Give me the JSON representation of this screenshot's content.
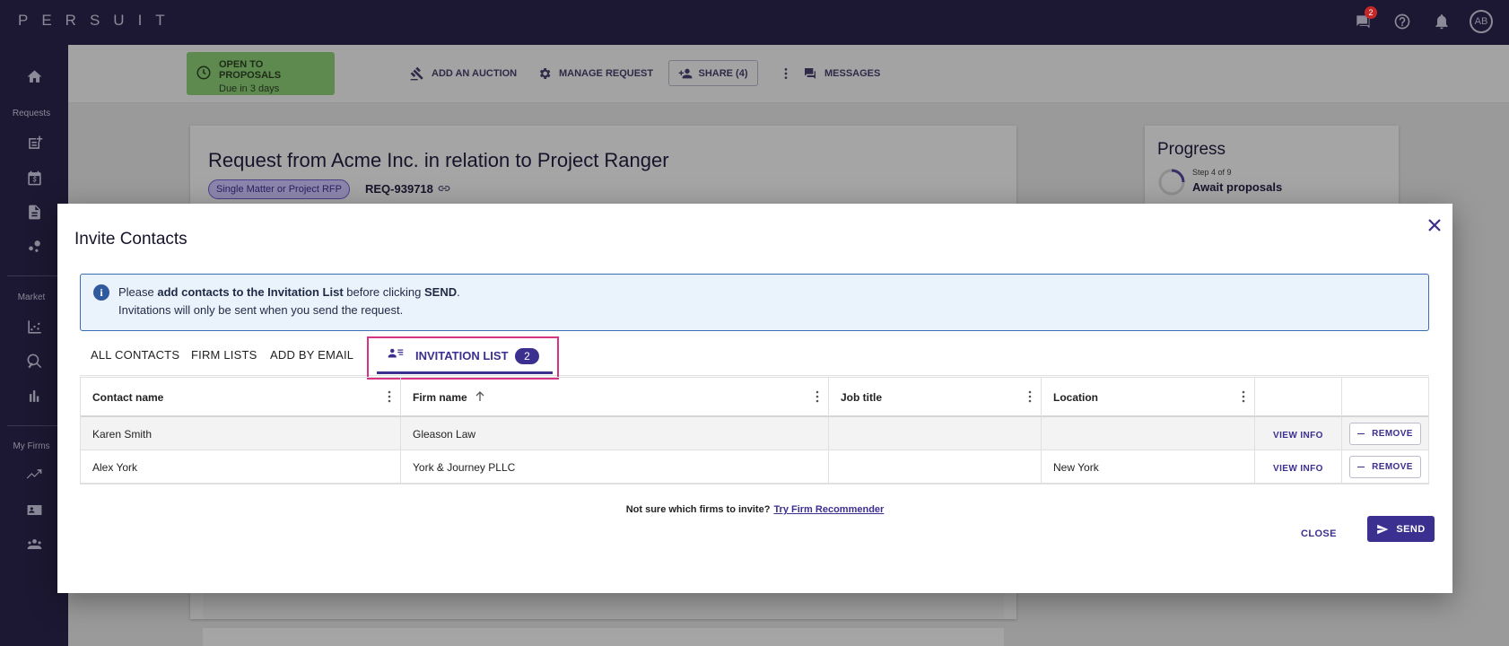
{
  "app": {
    "logo": "PERSUIT",
    "avatar_initials": "AB",
    "messages_badge": "2"
  },
  "sidebar": {
    "requests_label": "Requests",
    "market_label": "Market",
    "myfirms_label": "My Firms"
  },
  "background": {
    "status_title": "OPEN TO PROPOSALS",
    "status_sub": "Due in 3 days",
    "actions": {
      "auction": "ADD AN AUCTION",
      "manage": "MANAGE REQUEST",
      "share": "SHARE (4)",
      "messages": "MESSAGES"
    },
    "request_title": "Request from Acme Inc. in relation to Project Ranger",
    "request_tag": "Single Matter or Project RFP",
    "request_id": "REQ-939718",
    "progress_title": "Progress",
    "progress_step": "Step 4 of 9",
    "progress_name": "Await proposals"
  },
  "modal": {
    "title": "Invite Contacts",
    "info": {
      "pre": "Please ",
      "bold1": "add contacts to the Invitation List",
      "mid": " before clicking ",
      "bold2": "SEND",
      "post": ".",
      "line2": "Invitations will only be sent when you send the request."
    },
    "tabs": [
      "ALL CONTACTS",
      "FIRM LISTS",
      "ADD BY EMAIL"
    ],
    "active_tab": {
      "label": "INVITATION LIST",
      "count": "2"
    },
    "table": {
      "headers": [
        "Contact name",
        "Firm name",
        "Job title",
        "Location"
      ],
      "rows": [
        {
          "contact": "Karen Smith",
          "firm": "Gleason Law",
          "job": "",
          "location": ""
        },
        {
          "contact": "Alex York",
          "firm": "York & Journey PLLC",
          "job": "",
          "location": "New York"
        }
      ],
      "view_info": "VIEW INFO",
      "remove": "REMOVE"
    },
    "recommend_text": "Not sure which firms to invite?",
    "recommend_link": "Try Firm Recommender",
    "close": "CLOSE",
    "send": "SEND"
  }
}
